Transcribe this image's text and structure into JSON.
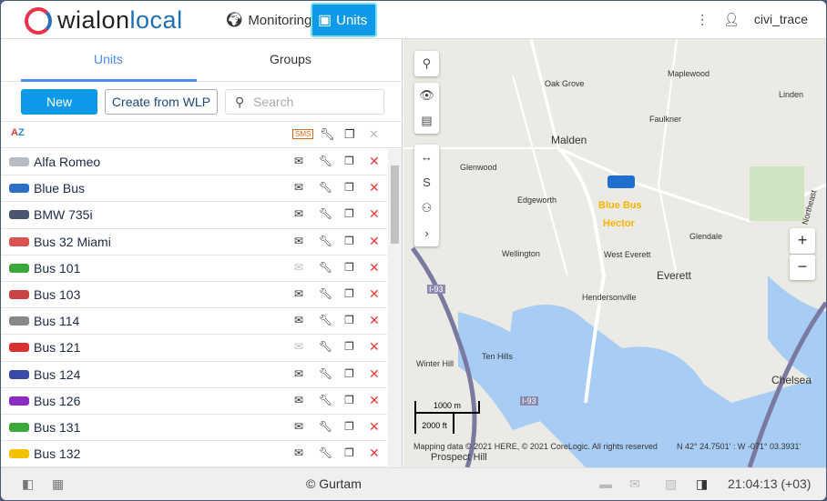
{
  "header": {
    "logo": "wialonlocal",
    "nav": [
      {
        "label": "Monitoring",
        "icon": "globe-icon"
      },
      {
        "label": "Units",
        "icon": "bus-icon",
        "active": true
      }
    ],
    "user": "civi_trace"
  },
  "panel": {
    "tabs": [
      "Units",
      "Groups"
    ],
    "new_label": "New",
    "create_label": "Create from WLP",
    "search_placeholder": "Search",
    "units": [
      {
        "name": "Alfa Romeo",
        "color": "#b8bcc4",
        "msg_enabled": true
      },
      {
        "name": "Blue Bus",
        "color": "#2d6fc6",
        "msg_enabled": true
      },
      {
        "name": "BMW 735i",
        "color": "#4a5670",
        "msg_enabled": true
      },
      {
        "name": "Bus 32 Miami",
        "color": "#d9534f",
        "msg_enabled": true
      },
      {
        "name": "Bus 101",
        "color": "#3aa83a",
        "msg_enabled": false
      },
      {
        "name": "Bus 103",
        "color": "#c94444",
        "msg_enabled": true
      },
      {
        "name": "Bus 114",
        "color": "#888888",
        "msg_enabled": true
      },
      {
        "name": "Bus 121",
        "color": "#d93030",
        "msg_enabled": false
      },
      {
        "name": "Bus 124",
        "color": "#3a4aa8",
        "msg_enabled": true
      },
      {
        "name": "Bus 126",
        "color": "#8a2bc2",
        "msg_enabled": true
      },
      {
        "name": "Bus 131",
        "color": "#3aa83a",
        "msg_enabled": true
      },
      {
        "name": "Bus 132",
        "color": "#f2c200",
        "msg_enabled": true
      }
    ]
  },
  "map": {
    "labels": [
      "Maplewood",
      "Oak Grove",
      "Linden",
      "Faulkner",
      "Malden",
      "Glenwood",
      "Edgeworth",
      "Glendale",
      "Wellington",
      "West Everett",
      "Everett",
      "Hendersonville",
      "Ten Hills",
      "Winter Hill",
      "Chelsea",
      "Prospect Hill",
      "I-93",
      "I-93",
      "Northeast"
    ],
    "markers": [
      "Blue Bus",
      "Hector"
    ],
    "scale_m": "1000 m",
    "scale_ft": "2000 ft",
    "attribution": "Mapping data © 2021 HERE, © 2021 CoreLogic. All rights reserved",
    "coords": "N 42° 24.7501' : W -071° 03.3931'"
  },
  "footer": {
    "copyright": "© Gurtam",
    "time": "21:04:13 (+03)"
  }
}
